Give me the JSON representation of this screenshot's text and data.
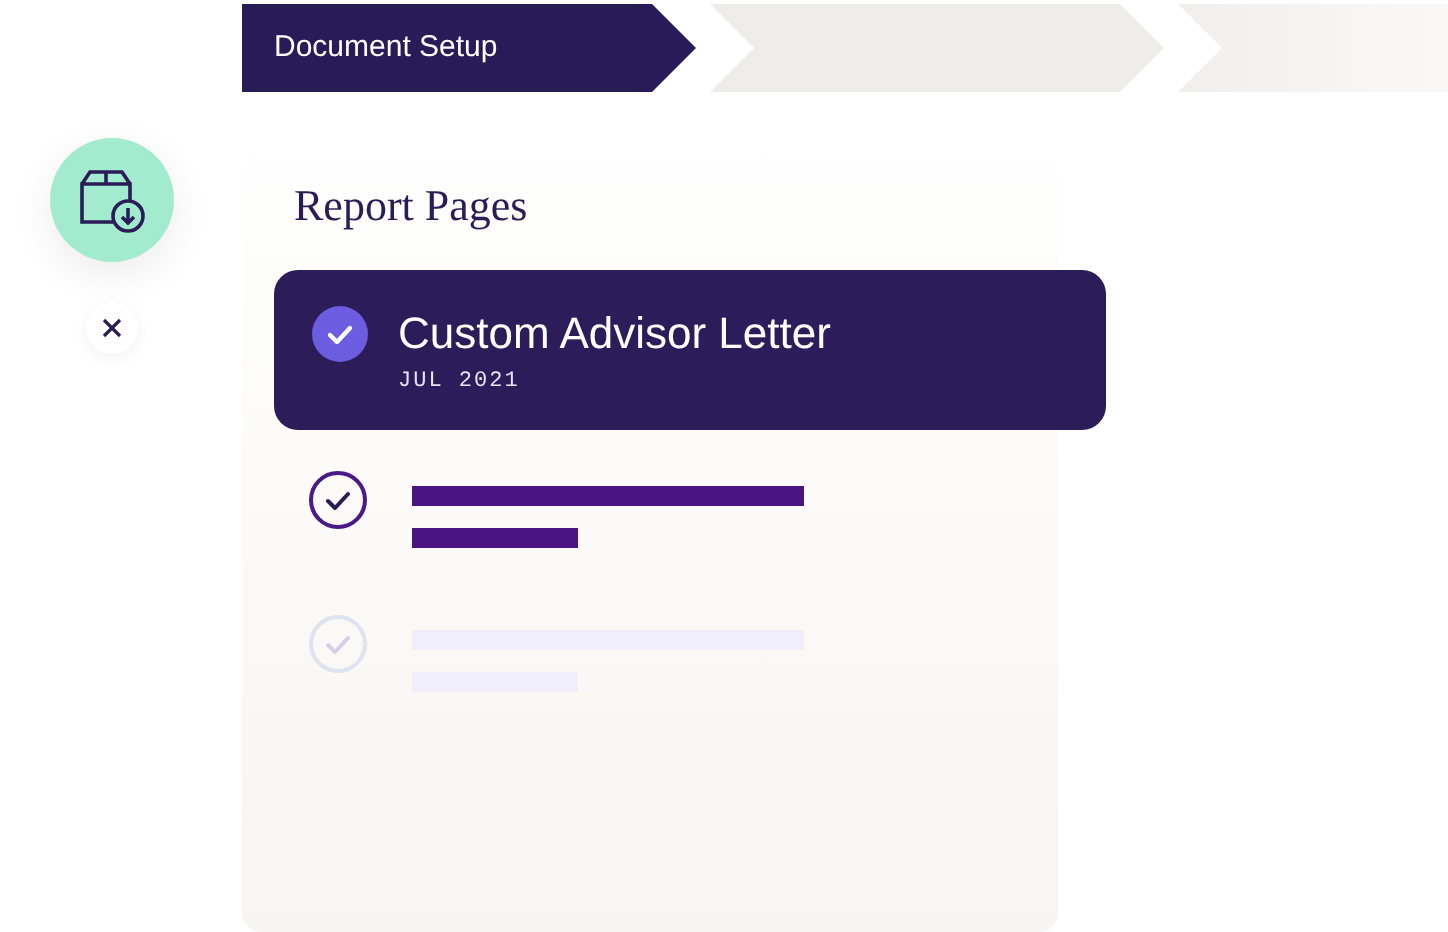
{
  "steps": [
    {
      "label": "Document Setup",
      "selected": true
    },
    {
      "selected": false
    },
    {
      "selected": false
    }
  ],
  "report": {
    "title": "Report Pages",
    "pages": [
      {
        "kind": "card",
        "checked": true,
        "title": "Custom Advisor Letter",
        "date": "JUL 2021"
      },
      {
        "kind": "placeholder",
        "checked": true
      },
      {
        "kind": "placeholder",
        "checked": false
      }
    ]
  }
}
